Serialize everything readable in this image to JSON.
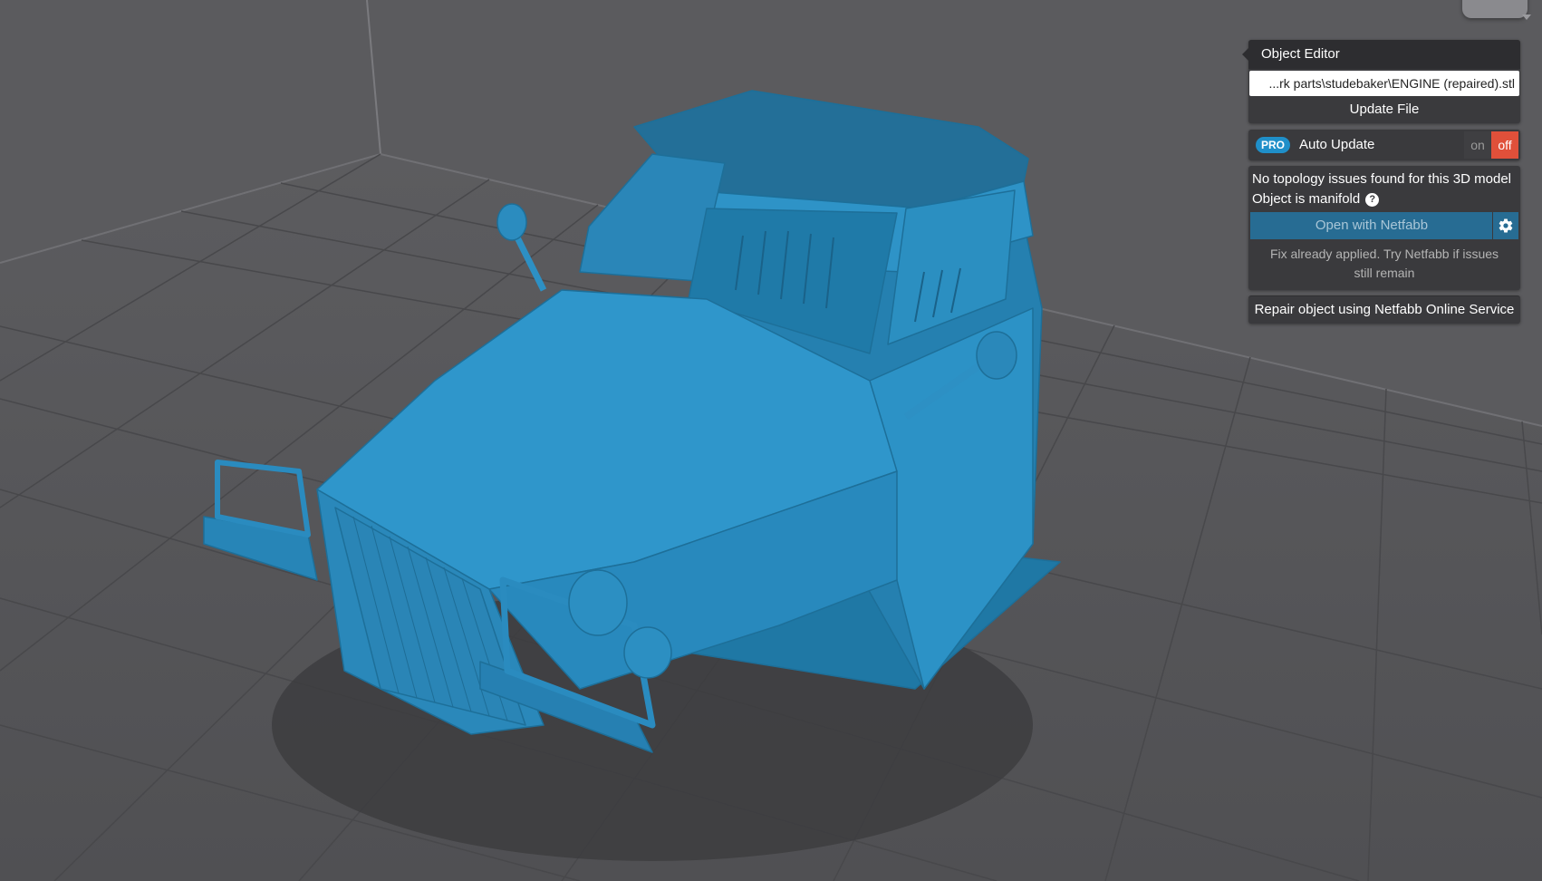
{
  "object_editor": {
    "title": "Object Editor",
    "file_path": "...rk parts\\studebaker\\ENGINE (repaired).stl",
    "update_file_label": "Update File",
    "pro_badge": "PRO",
    "auto_update_label": "Auto Update",
    "toggle_on_label": "on",
    "toggle_off_label": "off",
    "auto_update_state": "off",
    "topology_status": "No topology issues found for this 3D model",
    "manifold_status": "Object is manifold",
    "help_icon": "?",
    "open_netfabb_label": "Open with Netfabb",
    "fix_note": "Fix already applied. Try Netfabb if issues still remain",
    "repair_label": "Repair object using Netfabb Online Service"
  },
  "icons": {
    "help": "question-circle-icon",
    "settings": "gear-icon",
    "view_cube": "view-cube-icon"
  },
  "colors": {
    "background": "#5b5b5e",
    "model": "#2a8bbf",
    "pro_badge": "#1f8fc9",
    "toggle_off": "#e0503a",
    "netfabb_button": "#276c93"
  }
}
